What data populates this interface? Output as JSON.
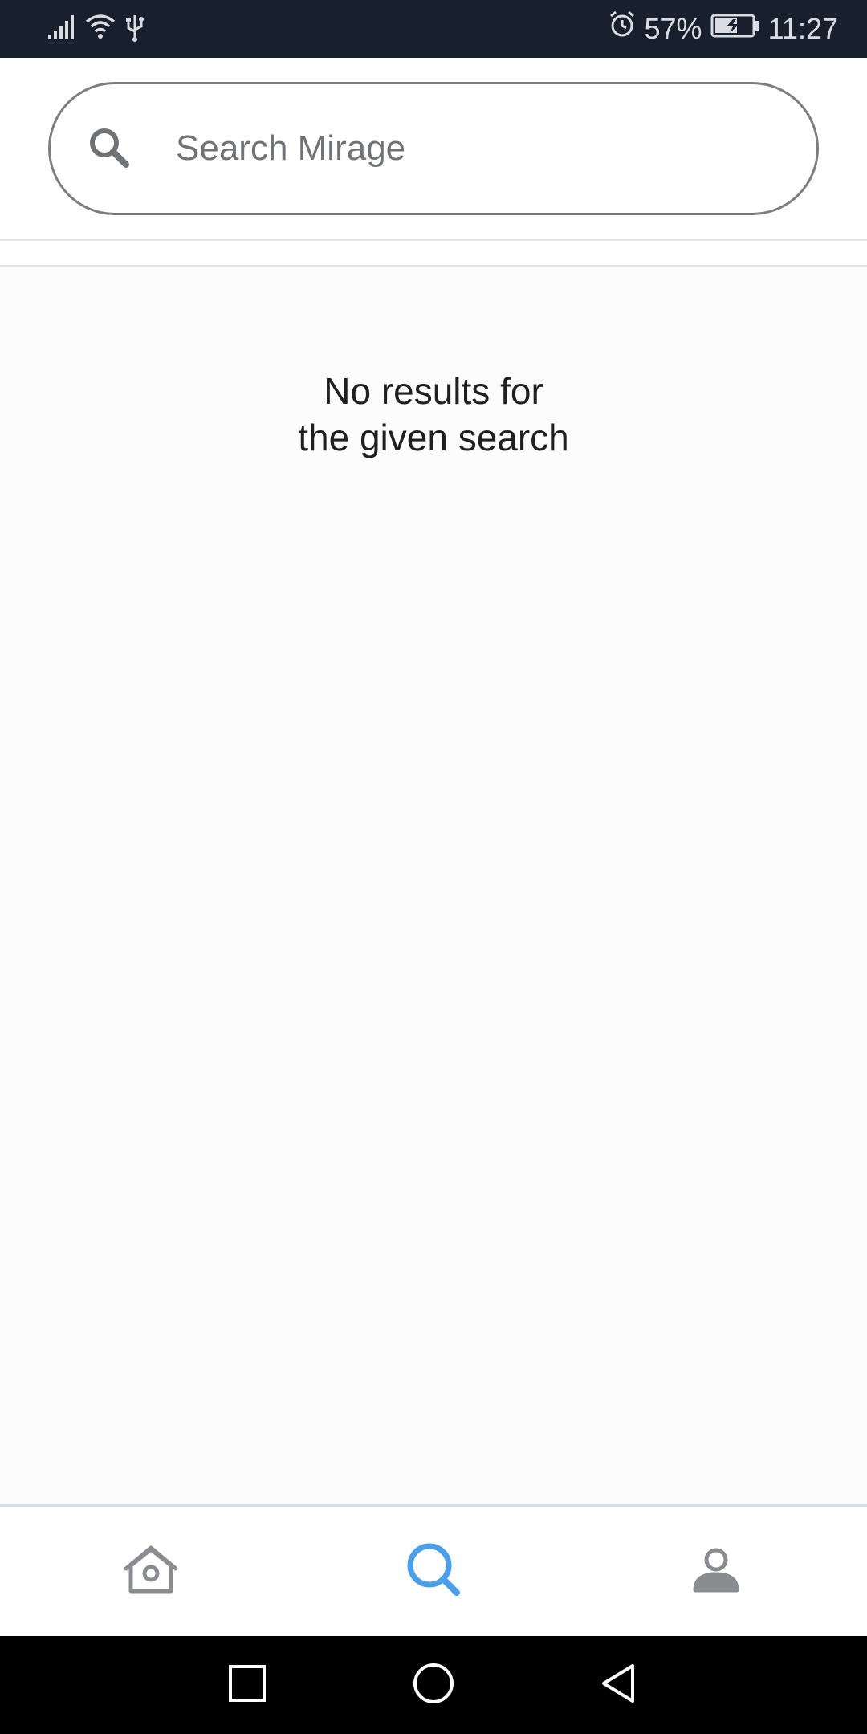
{
  "status_bar": {
    "battery_percent": "57%",
    "time": "11:27"
  },
  "search": {
    "placeholder": "Search Mirage",
    "value": ""
  },
  "empty_state": {
    "line1": "No results for",
    "line2": "the given search"
  },
  "bottom_nav": {
    "items": [
      {
        "name": "home",
        "icon": "home-icon",
        "active": false
      },
      {
        "name": "search",
        "icon": "search-icon",
        "active": true
      },
      {
        "name": "profile",
        "icon": "profile-icon",
        "active": false
      }
    ]
  },
  "colors": {
    "status_bar_bg": "#18202d",
    "accent": "#4a9fe8",
    "icon_inactive": "#8a8c90",
    "android_nav_bg": "#000000"
  }
}
